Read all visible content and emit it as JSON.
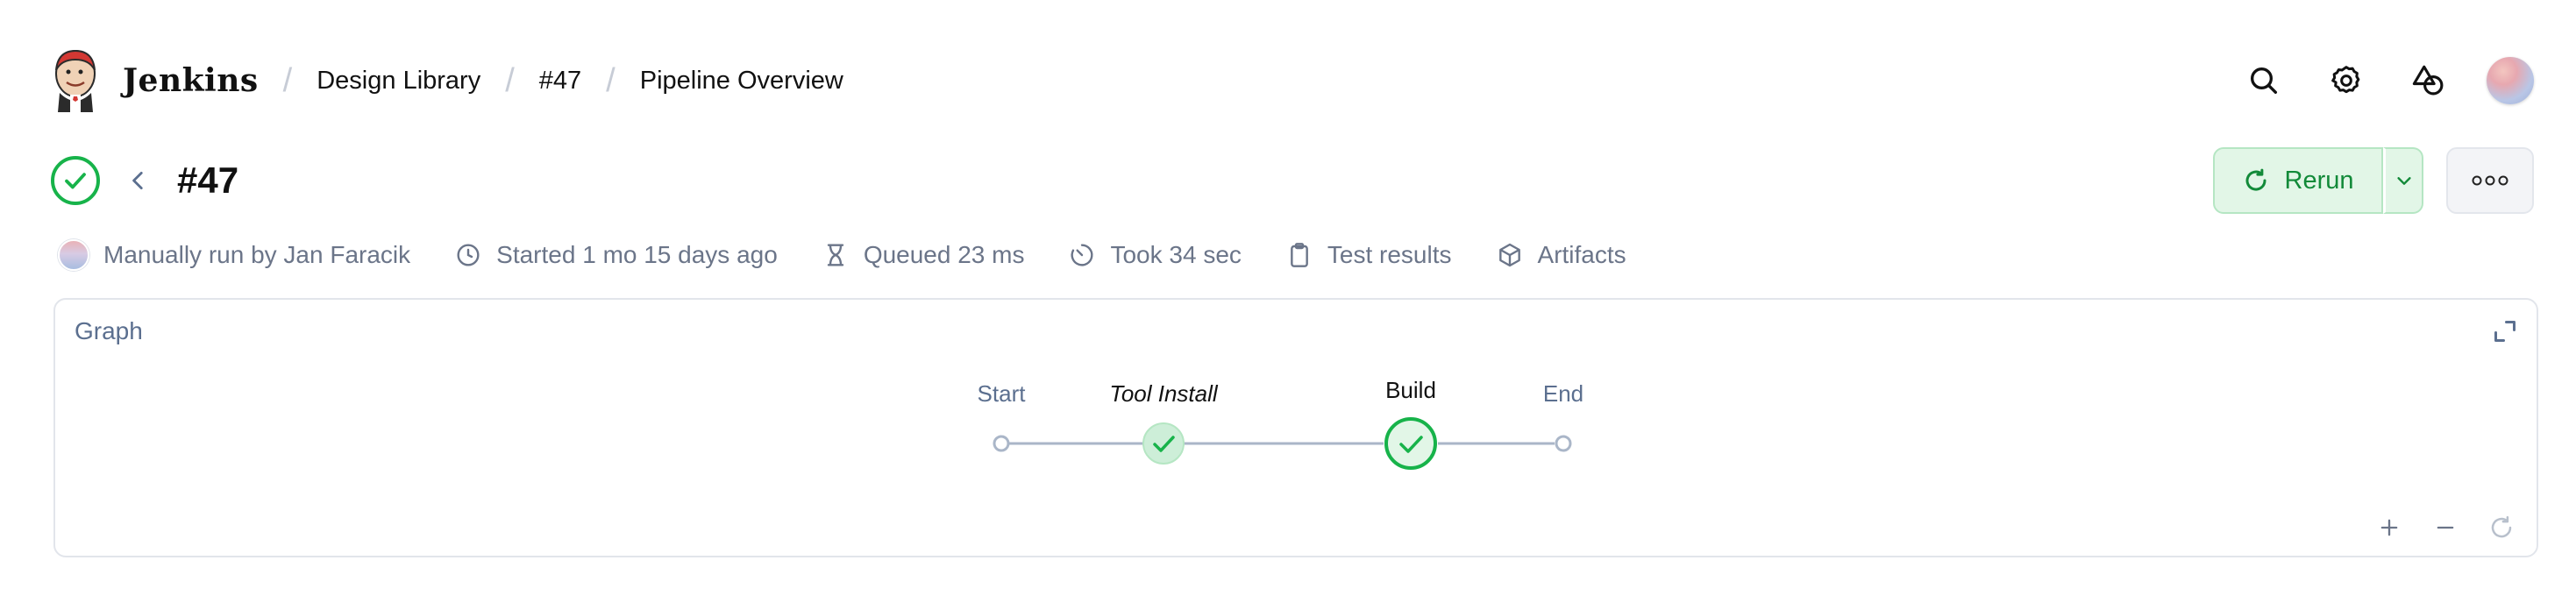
{
  "header": {
    "brand": "Jenkins",
    "breadcrumbs": [
      "Design Library",
      "#47",
      "Pipeline Overview"
    ],
    "icons": [
      "search-icon",
      "gear-icon",
      "shapes-icon",
      "user-avatar"
    ]
  },
  "run": {
    "title": "#47",
    "status": "success",
    "rerun_label": "Rerun"
  },
  "meta": {
    "run_by": "Manually run by Jan Faracik",
    "started": "Started 1 mo 15 days ago",
    "queued": "Queued 23 ms",
    "took": "Took 34 sec",
    "test_results": "Test results",
    "artifacts": "Artifacts"
  },
  "graph": {
    "title": "Graph",
    "nodes": [
      {
        "label": "Start",
        "kind": "terminal"
      },
      {
        "label": "Tool Install",
        "kind": "stage-small",
        "status": "success"
      },
      {
        "label": "Build",
        "kind": "stage",
        "status": "success"
      },
      {
        "label": "End",
        "kind": "terminal"
      }
    ]
  },
  "colors": {
    "success": "#17b34a",
    "success_bg": "#e2f6e7",
    "muted_text": "#6b7589",
    "graph_line": "#aab6c8"
  }
}
